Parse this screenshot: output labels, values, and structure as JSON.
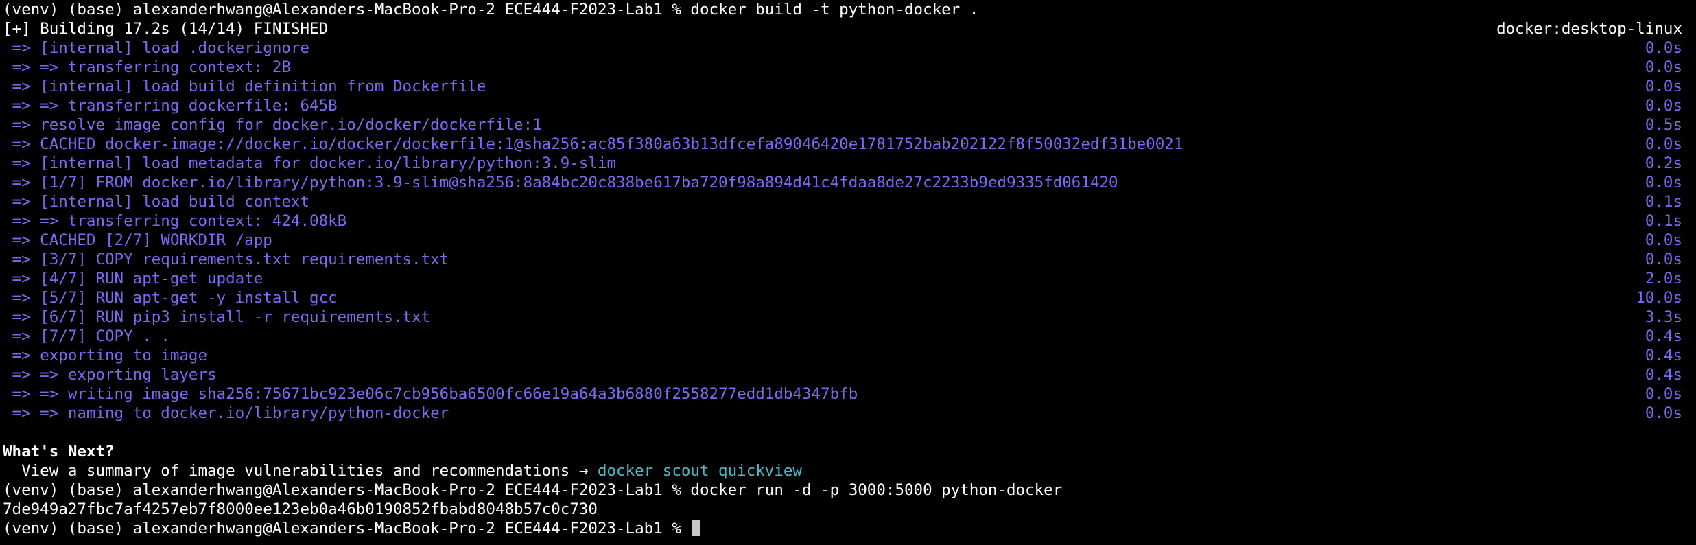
{
  "colors": {
    "background": "#000000",
    "text": "#ffffff",
    "step": "#7b69f0",
    "link": "#4fb8ca",
    "cursor": "#c7c7c7"
  },
  "prompt": "(venv) (base) alexanderhwang@Alexanders-MacBook-Pro-2 ECE444-F2023-Lab1 %",
  "commands": {
    "build": " docker build -t python-docker .",
    "run": " docker run -d -p 3000:5000 python-docker"
  },
  "build_header": {
    "status": "[+] Building 17.2s (14/14) FINISHED",
    "platform": "docker:desktop-linux"
  },
  "steps": [
    {
      "text": " => [internal] load .dockerignore",
      "time": "0.0s"
    },
    {
      "text": " => => transferring context: 2B",
      "time": "0.0s"
    },
    {
      "text": " => [internal] load build definition from Dockerfile",
      "time": "0.0s"
    },
    {
      "text": " => => transferring dockerfile: 645B",
      "time": "0.0s"
    },
    {
      "text": " => resolve image config for docker.io/docker/dockerfile:1",
      "time": "0.5s"
    },
    {
      "text": " => CACHED docker-image://docker.io/docker/dockerfile:1@sha256:ac85f380a63b13dfcefa89046420e1781752bab202122f8f50032edf31be0021",
      "time": "0.0s"
    },
    {
      "text": " => [internal] load metadata for docker.io/library/python:3.9-slim",
      "time": "0.2s"
    },
    {
      "text": " => [1/7] FROM docker.io/library/python:3.9-slim@sha256:8a84bc20c838be617ba720f98a894d41c4fdaa8de27c2233b9ed9335fd061420",
      "time": "0.0s"
    },
    {
      "text": " => [internal] load build context",
      "time": "0.1s"
    },
    {
      "text": " => => transferring context: 424.08kB",
      "time": "0.1s"
    },
    {
      "text": " => CACHED [2/7] WORKDIR /app",
      "time": "0.0s"
    },
    {
      "text": " => [3/7] COPY requirements.txt requirements.txt",
      "time": "0.0s"
    },
    {
      "text": " => [4/7] RUN apt-get update",
      "time": "2.0s"
    },
    {
      "text": " => [5/7] RUN apt-get -y install gcc",
      "time": "10.0s"
    },
    {
      "text": " => [6/7] RUN pip3 install -r requirements.txt",
      "time": "3.3s"
    },
    {
      "text": " => [7/7] COPY . .",
      "time": "0.4s"
    },
    {
      "text": " => exporting to image",
      "time": "0.4s"
    },
    {
      "text": " => => exporting layers",
      "time": "0.4s"
    },
    {
      "text": " => => writing image sha256:75671bc923e06c7cb956ba6500fc66e19a64a3b6880f2558277edd1db4347bfb",
      "time": "0.0s"
    },
    {
      "text": " => => naming to docker.io/library/python-docker",
      "time": "0.0s"
    }
  ],
  "whats_next": {
    "title": "What's Next?",
    "hint": "  View a summary of image vulnerabilities and recommendations → ",
    "command": "docker scout quickview"
  },
  "container_id": "7de949a27fbc7af4257eb7f8000ee123eb0a46b0190852fbabd8048b57c0c730"
}
